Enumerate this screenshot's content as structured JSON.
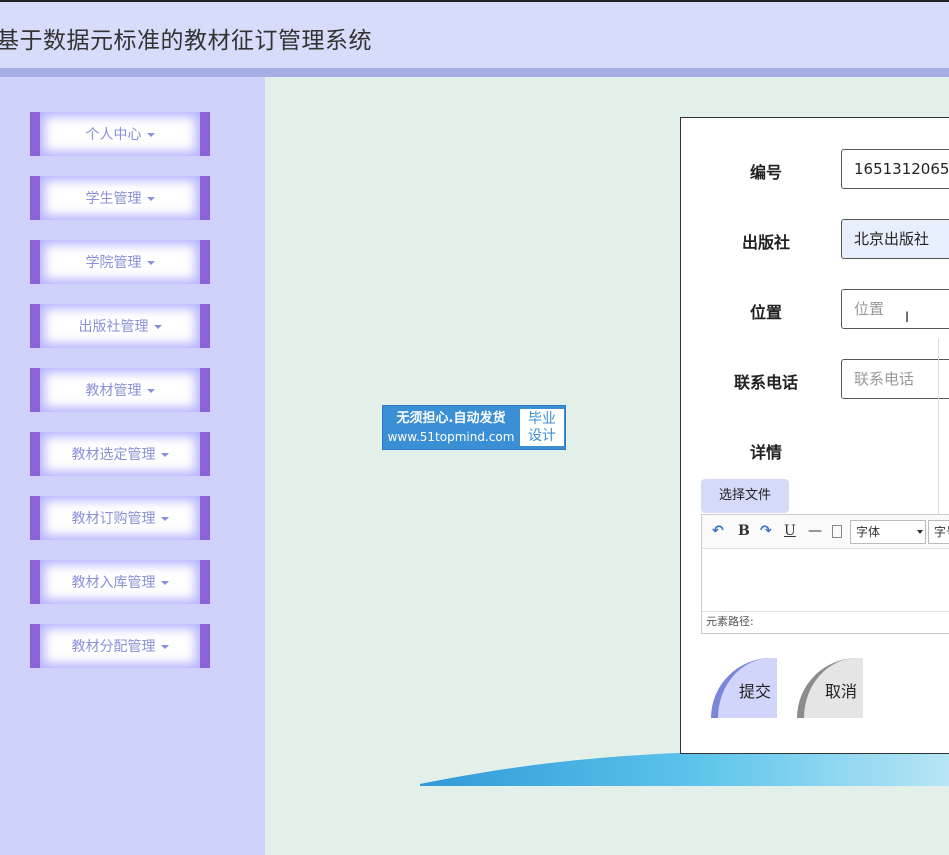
{
  "header": {
    "title": "基于数据元标准的教材征订管理系统"
  },
  "sidebar": {
    "items": [
      {
        "label": "个人中心"
      },
      {
        "label": "学生管理"
      },
      {
        "label": "学院管理"
      },
      {
        "label": "出版社管理"
      },
      {
        "label": "教材管理"
      },
      {
        "label": "教材选定管理"
      },
      {
        "label": "教材订购管理"
      },
      {
        "label": "教材入库管理"
      },
      {
        "label": "教材分配管理"
      }
    ]
  },
  "ad": {
    "line1": "无须担心.自动发货",
    "line2": "www.51topmind.com",
    "badge1": "毕业",
    "badge2": "设计"
  },
  "form": {
    "id_label": "编号",
    "id_value": "1651312065",
    "publisher_label": "出版社",
    "publisher_value": "北京出版社",
    "location_label": "位置",
    "location_placeholder": "位置",
    "phone_label": "联系电话",
    "phone_placeholder": "联系电话",
    "details_label": "详情",
    "file_button": "选择文件",
    "editor": {
      "font_select": "字体",
      "size_select": "字号",
      "element_path": "元素路径:"
    },
    "submit_label": "提交",
    "cancel_label": "取消"
  },
  "colors": {
    "header_bg": "#d7dcfb",
    "sidebar_bg": "#cfd2fb",
    "menu_accent": "#8b62d8",
    "main_bg": "#e3efe9",
    "submit_accent": "#7c86d9"
  }
}
